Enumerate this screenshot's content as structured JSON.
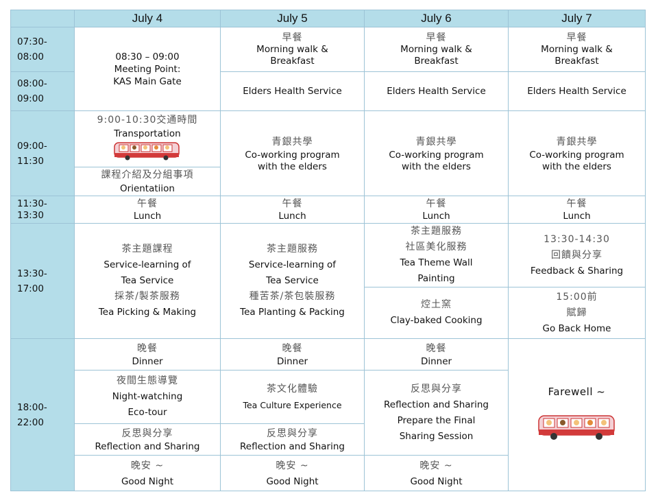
{
  "header": {
    "days": [
      "July 4",
      "July 5",
      "July 6",
      "July 7"
    ]
  },
  "times": [
    "07:30-",
    "08:00",
    "08:00-",
    "09:00",
    "09:00-",
    "11:30",
    "11:30-",
    "13:30",
    "13:30-",
    "17:00",
    "18:00-",
    "22:00"
  ],
  "d4": {
    "meeting": [
      "08:30 – 09:00",
      "Meeting Point:",
      "KAS Main Gate"
    ],
    "transport_zh": "9:00-10:30交通時間",
    "transport_en": "Transportation",
    "orient_zh": "課程介紹及分組事項",
    "orient_en": "Orientatiion",
    "tea": [
      "茶主題課程",
      "Service-learning of",
      "Tea Service",
      "採茶/製茶服務",
      "Tea Picking & Making"
    ],
    "night": [
      "夜間生態導覽",
      "Night-watching",
      "Eco-tour"
    ],
    "reflect_zh": "反思與分享",
    "reflect_en": "Reflection and Sharing"
  },
  "d5": {
    "tea": [
      "茶主題服務",
      "Service-learning of",
      "Tea Service",
      "種苦茶/茶包裝服務",
      "Tea Planting & Packing"
    ],
    "culture_zh": "茶文化體驗",
    "culture_en": "Tea Culture Experience",
    "reflect_zh": "反思與分享",
    "reflect_en": "Reflection and Sharing"
  },
  "d6": {
    "wall": [
      "茶主題服務",
      "社區美化服務",
      "Tea Theme Wall",
      "Painting"
    ],
    "clay_zh": "焢土窯",
    "clay_en": "Clay-baked Cooking",
    "reflect": [
      "反思與分享",
      "Reflection and Sharing",
      "Prepare the Final",
      "Sharing Session"
    ]
  },
  "d7": {
    "feedback": [
      "13:30-14:30",
      "回饋與分享",
      "Feedback & Sharing"
    ],
    "home": [
      "15:00前",
      "賦歸",
      "Go Back Home"
    ],
    "farewell": "Farewell ~"
  },
  "common": {
    "breakfast_zh": "早餐",
    "breakfast_en": [
      "Morning walk &",
      "Breakfast"
    ],
    "elders": "Elders Health Service",
    "cowork_zh": "青銀共學",
    "cowork_en": [
      "Co-working program",
      "with the elders"
    ],
    "lunch_zh": "午餐",
    "lunch_en": "Lunch",
    "dinner_zh": "晚餐",
    "dinner_en": "Dinner",
    "night_zh": "晚安 ~",
    "night_en": "Good Night"
  },
  "icons": {
    "bus": "school-bus-with-children-icon"
  },
  "colors": {
    "header_bg": "#b4dde9",
    "border": "#9cc3d6",
    "chinese_text": "#555555"
  }
}
